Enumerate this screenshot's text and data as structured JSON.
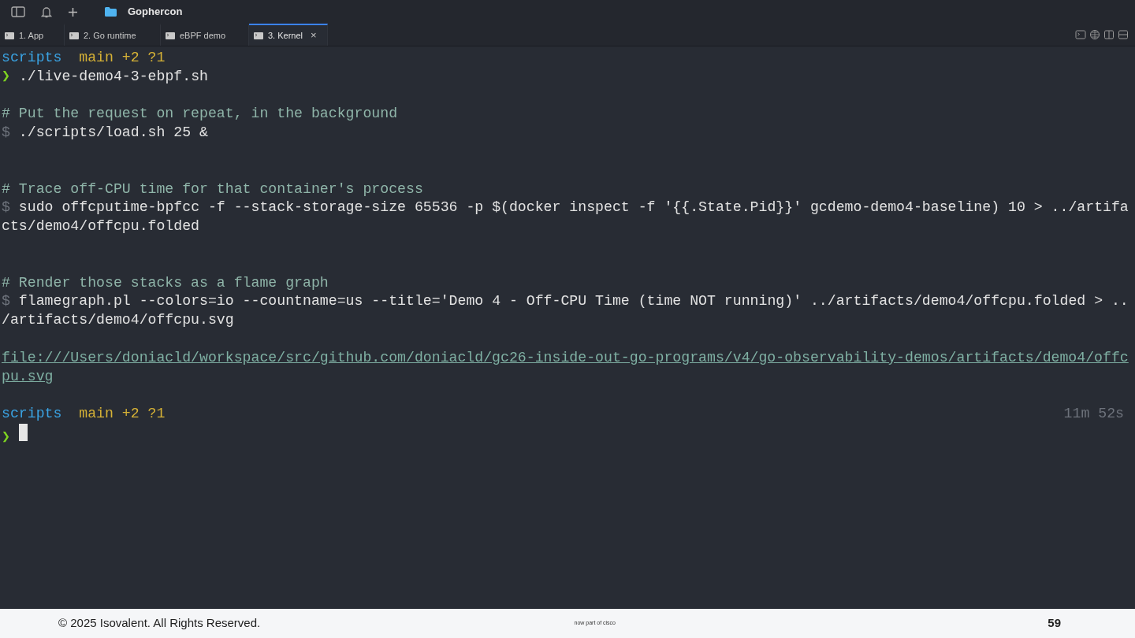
{
  "window": {
    "title": "Gophercon"
  },
  "tabs": [
    {
      "label": "1. App",
      "selected": false
    },
    {
      "label": "2. Go runtime",
      "selected": false
    },
    {
      "label": "eBPF demo",
      "selected": false
    },
    {
      "label": "3. Kernel",
      "selected": true,
      "close": "×"
    }
  ],
  "lines": [
    {
      "kind": "prompt_info",
      "dir": "scripts",
      "branch": "main",
      "status": "+2 ?1"
    },
    {
      "kind": "prompt",
      "symbol": "❯",
      "text": "./live-demo4-3-ebpf.sh",
      "cursor": false
    },
    {
      "kind": "blank"
    },
    {
      "kind": "comment",
      "text": "# Put the request on repeat, in the background"
    },
    {
      "kind": "command",
      "symbol": "$",
      "text": "./scripts/load.sh 25 &"
    },
    {
      "kind": "blank"
    },
    {
      "kind": "blank"
    },
    {
      "kind": "comment",
      "text": "# Trace off-CPU time for that container's process"
    },
    {
      "kind": "command",
      "symbol": "$",
      "text": "sudo offcputime-bpfcc -f --stack-storage-size 65536 -p $(docker inspect -f '{{.State.Pid}}' gcdemo-demo4-baseline) 10 > ../artifa"
    },
    {
      "kind": "wrap",
      "text": "cts/demo4/offcpu.folded"
    },
    {
      "kind": "blank"
    },
    {
      "kind": "blank"
    },
    {
      "kind": "comment",
      "text": "# Render those stacks as a flame graph"
    },
    {
      "kind": "command",
      "symbol": "$",
      "text": "flamegraph.pl --colors=io --countname=us --title='Demo 4 - Off-CPU Time (time NOT running)' ../artifacts/demo4/offcpu.folded > .."
    },
    {
      "kind": "wrap",
      "text": "/artifacts/demo4/offcpu.svg"
    },
    {
      "kind": "blank"
    },
    {
      "kind": "link",
      "text": "file:///Users/doniacld/workspace/src/github.com/doniacld/gc26-inside-out-go-programs/v4/go-observability-demos/artifacts/demo4/offc"
    },
    {
      "kind": "link",
      "text": "pu.svg"
    },
    {
      "kind": "blank"
    },
    {
      "kind": "prompt_info",
      "dir": "scripts",
      "branch": "main",
      "status": "+2 ?1",
      "duration": "11m 52s"
    },
    {
      "kind": "prompt",
      "symbol": "❯",
      "cursor": true
    }
  ],
  "footer": {
    "copyright": "© 2025 Isovalent. All Rights Reserved.",
    "logo_tagline": "now part of cisco",
    "page": "59"
  }
}
